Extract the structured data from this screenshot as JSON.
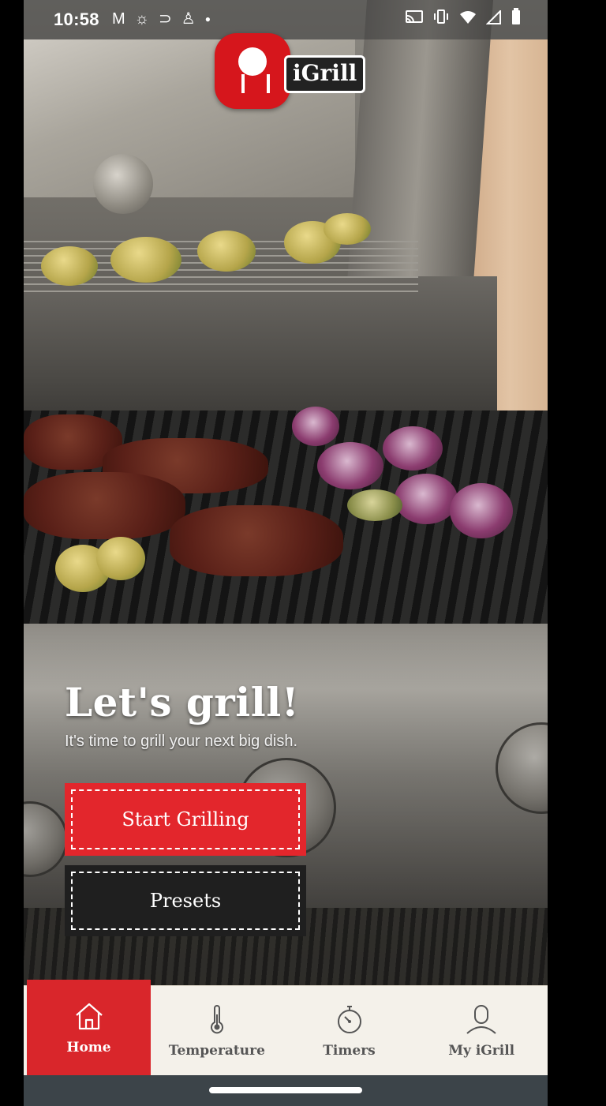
{
  "status_bar": {
    "time": "10:58",
    "left_icons": [
      "gmail-icon",
      "brightness-icon",
      "sync-icon",
      "alert-icon",
      "dot-icon"
    ],
    "right_icons": [
      "cast-icon",
      "vibrate-icon",
      "wifi-icon",
      "signal-icon",
      "battery-icon"
    ]
  },
  "header": {
    "logo_text": "iGrill"
  },
  "hero": {
    "title": "Let's grill!",
    "subtitle": "It's time to grill your next big dish."
  },
  "actions": {
    "start_label": "Start Grilling",
    "presets_label": "Presets"
  },
  "colors": {
    "brand_red": "#e3262c",
    "dark_button": "#1f1f1f",
    "nav_background": "#f4f1ea"
  },
  "bottom_nav": {
    "items": [
      {
        "label": "Home",
        "icon": "home-icon",
        "active": true
      },
      {
        "label": "Temperature",
        "icon": "thermometer-icon",
        "active": false
      },
      {
        "label": "Timers",
        "icon": "stopwatch-icon",
        "active": false
      },
      {
        "label": "My iGrill",
        "icon": "user-icon",
        "active": false
      }
    ]
  }
}
